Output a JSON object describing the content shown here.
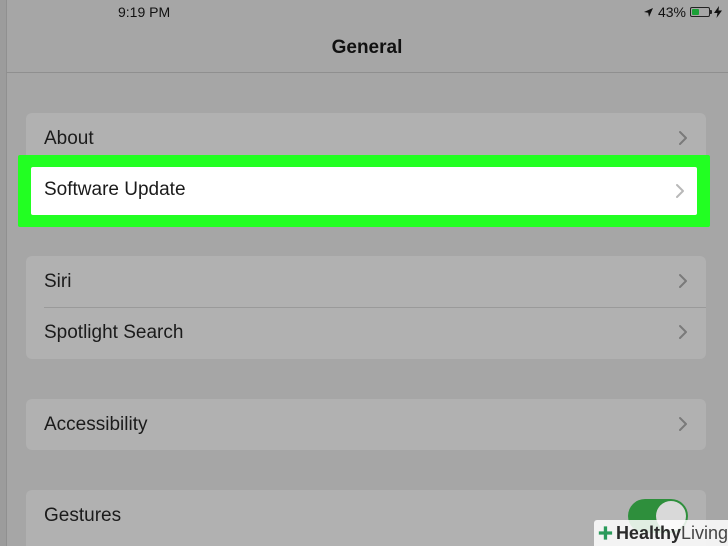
{
  "status_bar": {
    "time": "9:19 PM",
    "battery_percent_label": "43%",
    "battery_level": 0.43,
    "location_icon": "location-arrow-icon",
    "charging_icon": "charging-bolt-icon"
  },
  "nav": {
    "title": "General"
  },
  "groups": {
    "g1": {
      "about": "About",
      "software_update": "Software Update"
    },
    "g2": {
      "siri": "Siri",
      "spotlight": "Spotlight Search"
    },
    "g3": {
      "accessibility": "Accessibility"
    },
    "g4": {
      "gestures": "Gestures",
      "gestures_on": true
    }
  },
  "watermark": {
    "brand_bold": "Healthy",
    "brand_light": "Living"
  },
  "colors": {
    "highlight": "#22ff22",
    "toggle_on": "#2e8f3c",
    "battery": "#1aa036"
  }
}
